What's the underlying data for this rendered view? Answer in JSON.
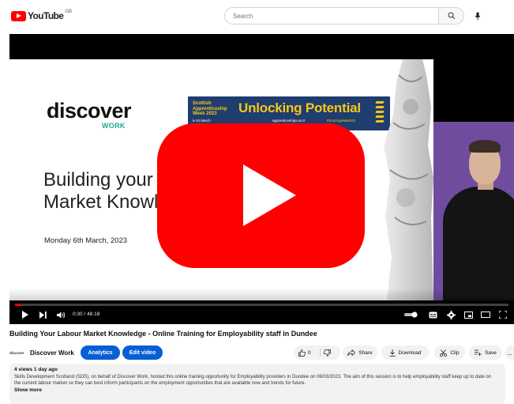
{
  "masthead": {
    "logo_text": "YouTube",
    "country_code": "GB",
    "search_placeholder": "Search"
  },
  "player": {
    "slide": {
      "brand_top": "discover",
      "brand_bottom": "WORK",
      "banner": {
        "left_line1": "Scottish",
        "left_line2": "Apprenticeship",
        "left_line3": "Week 2023",
        "dates": "6-10 March",
        "title": "Unlocking Potential",
        "url": "apprenticeships.scot",
        "hashtag": "#ScotAppWeek23"
      },
      "title_line1": "Building your Lo",
      "title_line2": "Market Knowle",
      "date": "Monday 6th March, 2023"
    },
    "time": "0:30 / 48:18",
    "progress_fraction": 0.0104
  },
  "video": {
    "title": "Building Your Labour Market Knowledge - Online Training for Employability staff in Dundee",
    "channel_avatar_text": "discover",
    "channel_name": "Discover Work",
    "analytics_label": "Analytics",
    "edit_label": "Edit video",
    "likes": "0",
    "share_label": "Share",
    "download_label": "Download",
    "clip_label": "Clip",
    "save_label": "Save",
    "more_label": "..."
  },
  "description": {
    "meta": "4 views  1 day ago",
    "text": "Skills Development Scotland (SDS), on behalf of Discover Work, hosted this online training opportunity for Employability providers in Dundee on 06/03/2023. The aim of this session is to help employability staff keep up to date on the current labour market so they can best inform participants on the employment opportunities that are available now and trends for future.",
    "show_more": "Show more"
  },
  "colors": {
    "accent_red": "#ff0000",
    "button_blue": "#065fd4",
    "banner_navy": "#1f3d6e",
    "banner_yellow": "#f5c816",
    "work_teal": "#1da88f",
    "panel_purple": "#6f4c9d"
  },
  "icons": [
    "youtube-logo-icon",
    "search-icon",
    "mic-icon",
    "play-icon",
    "next-icon",
    "volume-icon",
    "autoplay-toggle-icon",
    "subtitles-icon",
    "settings-icon",
    "miniplayer-icon",
    "theater-icon",
    "fullscreen-icon",
    "thumbs-up-icon",
    "thumbs-down-icon",
    "share-icon",
    "download-icon",
    "clip-icon",
    "save-icon"
  ]
}
